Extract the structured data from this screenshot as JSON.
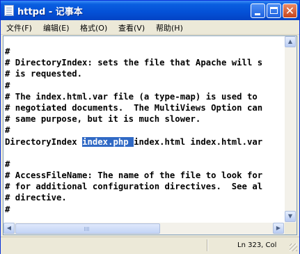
{
  "window": {
    "title": "httpd - 记事本",
    "controls": {
      "minimize": "minimize",
      "maximize": "maximize",
      "close": "✕"
    }
  },
  "menu": {
    "items": [
      "文件(F)",
      "编辑(E)",
      "格式(O)",
      "查看(V)",
      "帮助(H)"
    ]
  },
  "editor": {
    "lines": [
      "#",
      "# DirectoryIndex: sets the file that Apache will s",
      "# is requested.",
      "#",
      "# The index.html.var file (a type-map) is used to",
      "# negotiated documents.  The MultiViews Option can",
      "# same purpose, but it is much slower.",
      "#",
      "DirectoryIndex ",
      "",
      "#",
      "# AccessFileName: The name of the file to look for",
      "# for additional configuration directives.  See al",
      "# directive.",
      "#"
    ],
    "directory_index_selected": "index.php ",
    "directory_index_rest": "index.html index.html.var"
  },
  "statusbar": {
    "position": "Ln 323, Col"
  },
  "colors": {
    "titlebar": "#0450d6",
    "selection": "#316ac5",
    "chrome": "#ece9d8"
  }
}
